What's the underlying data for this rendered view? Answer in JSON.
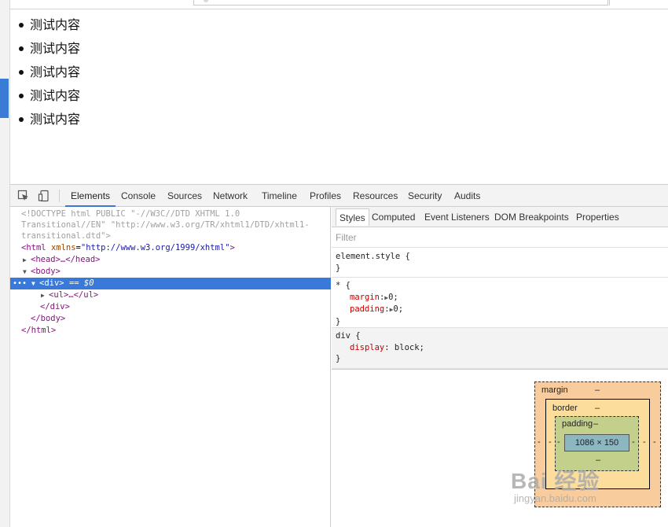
{
  "page": {
    "list_items": [
      "测试内容",
      "测试内容",
      "测试内容",
      "测试内容",
      "测试内容"
    ]
  },
  "devtools": {
    "tabs": [
      "Elements",
      "Console",
      "Sources",
      "Network",
      "Timeline",
      "Profiles",
      "Resources",
      "Security",
      "Audits"
    ],
    "active_tab": "Elements",
    "dom": {
      "doctype_1": "<!DOCTYPE html PUBLIC \"-//W3C//DTD XHTML 1.0",
      "doctype_2": "Transitional//EN\" \"http://www.w3.org/TR/xhtml1/DTD/xhtml1-",
      "doctype_3": "transitional.dtd\">",
      "html_open_tag": "<html",
      "html_attr_name": "xmlns",
      "html_attr_value": "\"http://www.w3.org/1999/xhtml\"",
      "html_open_close": ">",
      "head": "<head>…</head>",
      "body_open": "<body>",
      "div_open": "<div>",
      "div_marker": "== $0",
      "ul": "<ul>…</ul>",
      "div_close": "</div>",
      "body_close": "</body>",
      "html_close": "</html>",
      "dots": "•••"
    },
    "styles_tabs": [
      "Styles",
      "Computed",
      "Event Listeners",
      "DOM Breakpoints",
      "Properties"
    ],
    "active_styles_tab": "Styles",
    "filter_placeholder": "Filter",
    "rules": {
      "element_style": "element.style {",
      "star_selector": "* {",
      "margin_name": "margin",
      "margin_value": "0;",
      "padding_name": "padding",
      "padding_value": "0;",
      "div_selector": "div {",
      "display_name": "display",
      "display_value": "block;",
      "close_brace": "}"
    },
    "box_model": {
      "margin_label": "margin",
      "border_label": "border",
      "padding_label": "padding",
      "content_size": "1086 × 150",
      "dash": "–",
      "dash_left": "-",
      "dash_right": "-"
    }
  },
  "watermark": {
    "brand": "Bai 经验",
    "url": "jingyan.baidu.com"
  },
  "colors": {
    "selection": "#3879d9",
    "margin_box": "#f9cc9d",
    "border_box": "#fddd9b",
    "padding_box": "#c3d08b",
    "content_box": "#8cb6c0"
  }
}
